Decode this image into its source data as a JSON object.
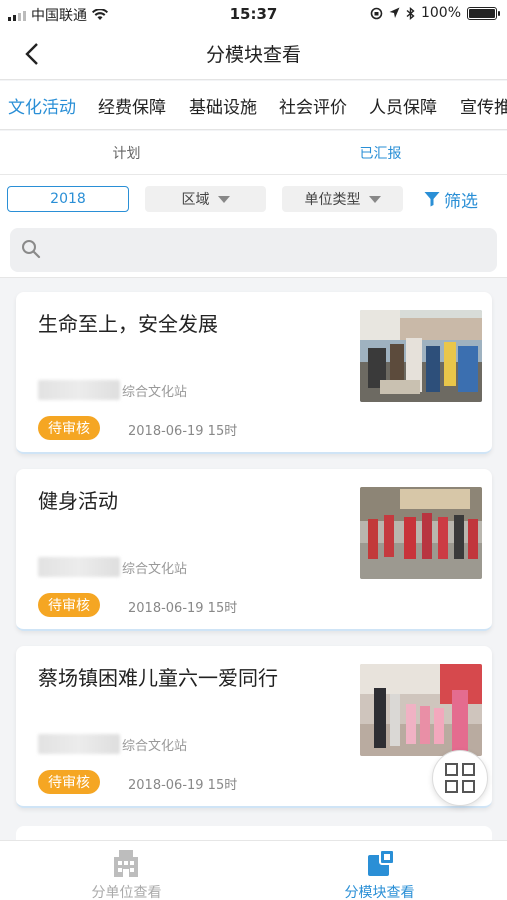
{
  "status_bar": {
    "carrier": "中国联通",
    "time": "15:37",
    "battery_text": "100%",
    "battery_level": 1.0
  },
  "nav": {
    "title": "分模块查看",
    "back_icon": "chevron-left-icon"
  },
  "module_tabs": [
    {
      "label": "文化活动",
      "active": true
    },
    {
      "label": "经费保障",
      "active": false
    },
    {
      "label": "基础设施",
      "active": false
    },
    {
      "label": "社会评价",
      "active": false
    },
    {
      "label": "人员保障",
      "active": false
    },
    {
      "label": "宣传推",
      "active": false
    }
  ],
  "sub_tabs": [
    {
      "label": "计划",
      "active": false
    },
    {
      "label": "已汇报",
      "active": true
    }
  ],
  "filters": {
    "year": "2018",
    "region": "区域",
    "unit_type": "单位类型",
    "filter_label": "筛选"
  },
  "search": {
    "placeholder": ""
  },
  "cards": [
    {
      "title": "生命至上，安全发展",
      "unit": "综合文化站",
      "status": "待审核",
      "date": "2018-06-19 15时"
    },
    {
      "title": "健身活动",
      "unit": "综合文化站",
      "status": "待审核",
      "date": "2018-06-19 15时"
    },
    {
      "title": "蔡场镇困难儿童六一爱同行",
      "unit": "综合文化站",
      "status": "待审核",
      "date": "2018-06-19 15时"
    }
  ],
  "bottom_tabs": [
    {
      "label": "分单位查看",
      "icon": "building-icon",
      "active": false
    },
    {
      "label": "分模块查看",
      "icon": "module-icon",
      "active": true
    }
  ],
  "colors": {
    "accent": "#2a8fd6",
    "badge": "#f5a623"
  }
}
